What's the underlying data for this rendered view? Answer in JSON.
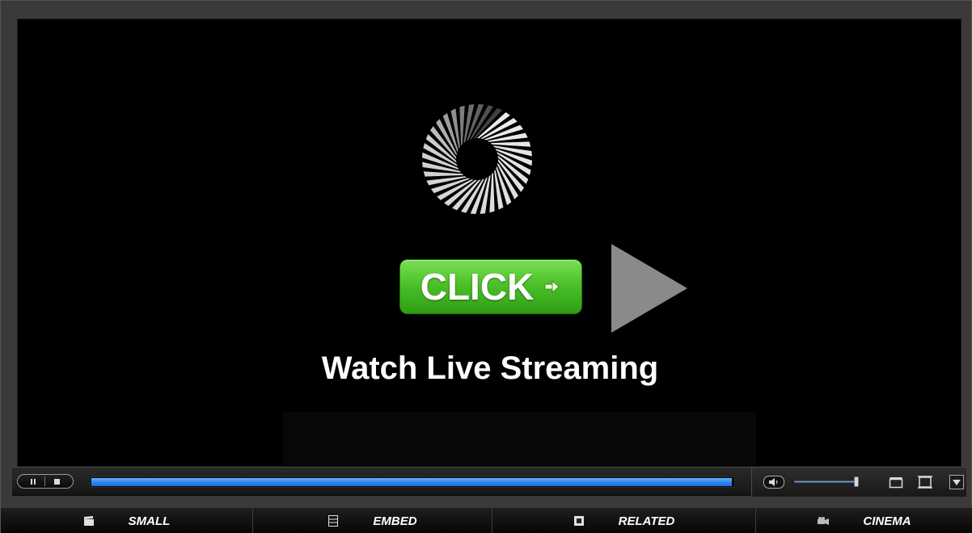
{
  "player": {
    "headline": "Watch Live Streaming",
    "click_button_label": "CLICK",
    "progress_fraction": 0.995,
    "volume_fraction": 0.97,
    "colors": {
      "click_green": "#4cc12a",
      "progress_blue": "#2f86f0",
      "background": "#000000"
    }
  },
  "controls": {
    "pause_icon": "pause-icon",
    "stop_icon": "stop-icon",
    "mute_icon": "speaker-icon",
    "minimize_icon": "window-icon",
    "fullscreen_icon": "fullscreen-icon",
    "dropdown_icon": "chevron-down-icon"
  },
  "menu": {
    "items": [
      {
        "label": "SMALL",
        "icon": "clapper-icon"
      },
      {
        "label": "EMBED",
        "icon": "embed-icon"
      },
      {
        "label": "RELATED",
        "icon": "related-icon"
      },
      {
        "label": "CINEMA",
        "icon": "projector-icon"
      }
    ]
  }
}
